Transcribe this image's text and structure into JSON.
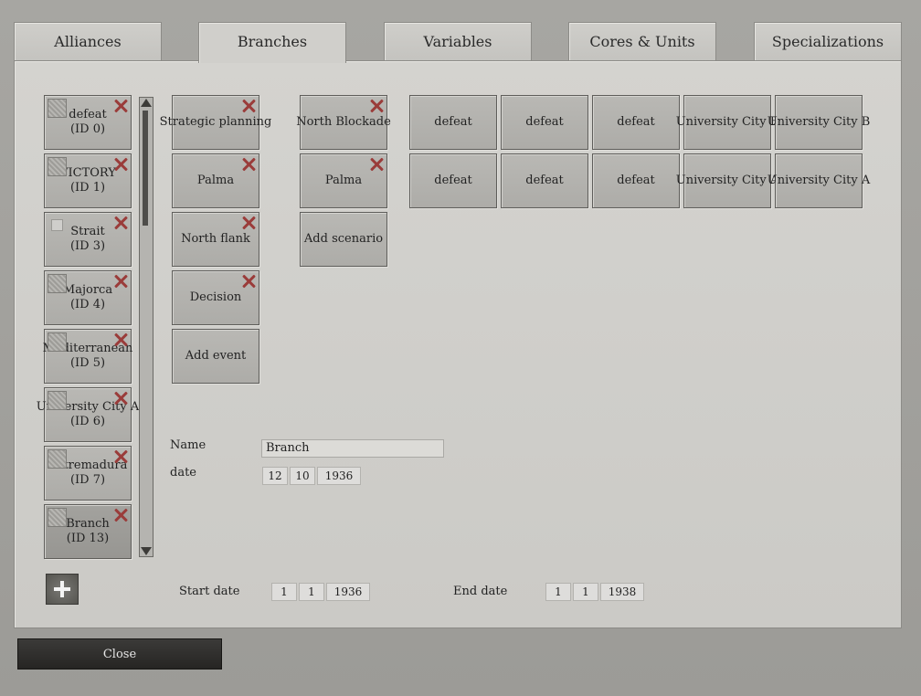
{
  "tabs": [
    {
      "label": "Alliances"
    },
    {
      "label": "Branches"
    },
    {
      "label": "Variables"
    },
    {
      "label": "Cores & Units"
    },
    {
      "label": "Specializations"
    }
  ],
  "branches": [
    {
      "name": "defeat",
      "id": "(ID 0)"
    },
    {
      "name": "VICTORY",
      "id": "(ID 1)"
    },
    {
      "name": "Strait",
      "id": "(ID 3)"
    },
    {
      "name": "Majorca",
      "id": "(ID 4)"
    },
    {
      "name": "Mediterranean",
      "id": "(ID 5)"
    },
    {
      "name": "University City A",
      "id": "(ID 6)"
    },
    {
      "name": "Extremadura",
      "id": "(ID 7)"
    },
    {
      "name": "Branch",
      "id": "(ID 13)"
    }
  ],
  "events": [
    "Strategic planning",
    "Palma",
    "North flank",
    "Decision"
  ],
  "add_event_label": "Add event",
  "scenarios": [
    "North Blockade",
    "Palma"
  ],
  "add_scenario_label": "Add scenario",
  "outcomes": [
    [
      "defeat",
      "defeat",
      "defeat",
      "University City B",
      "University City B"
    ],
    [
      "defeat",
      "defeat",
      "defeat",
      "University City A",
      "University City A"
    ]
  ],
  "form": {
    "name_label": "Name",
    "name_value": "Branch",
    "date_label": "date",
    "date": {
      "day": "12",
      "month": "10",
      "year": "1936"
    }
  },
  "footer": {
    "start_label": "Start date",
    "start": {
      "day": "1",
      "month": "1",
      "year": "1936"
    },
    "end_label": "End date",
    "end": {
      "day": "1",
      "month": "1",
      "year": "1938"
    }
  },
  "close_label": "Close"
}
